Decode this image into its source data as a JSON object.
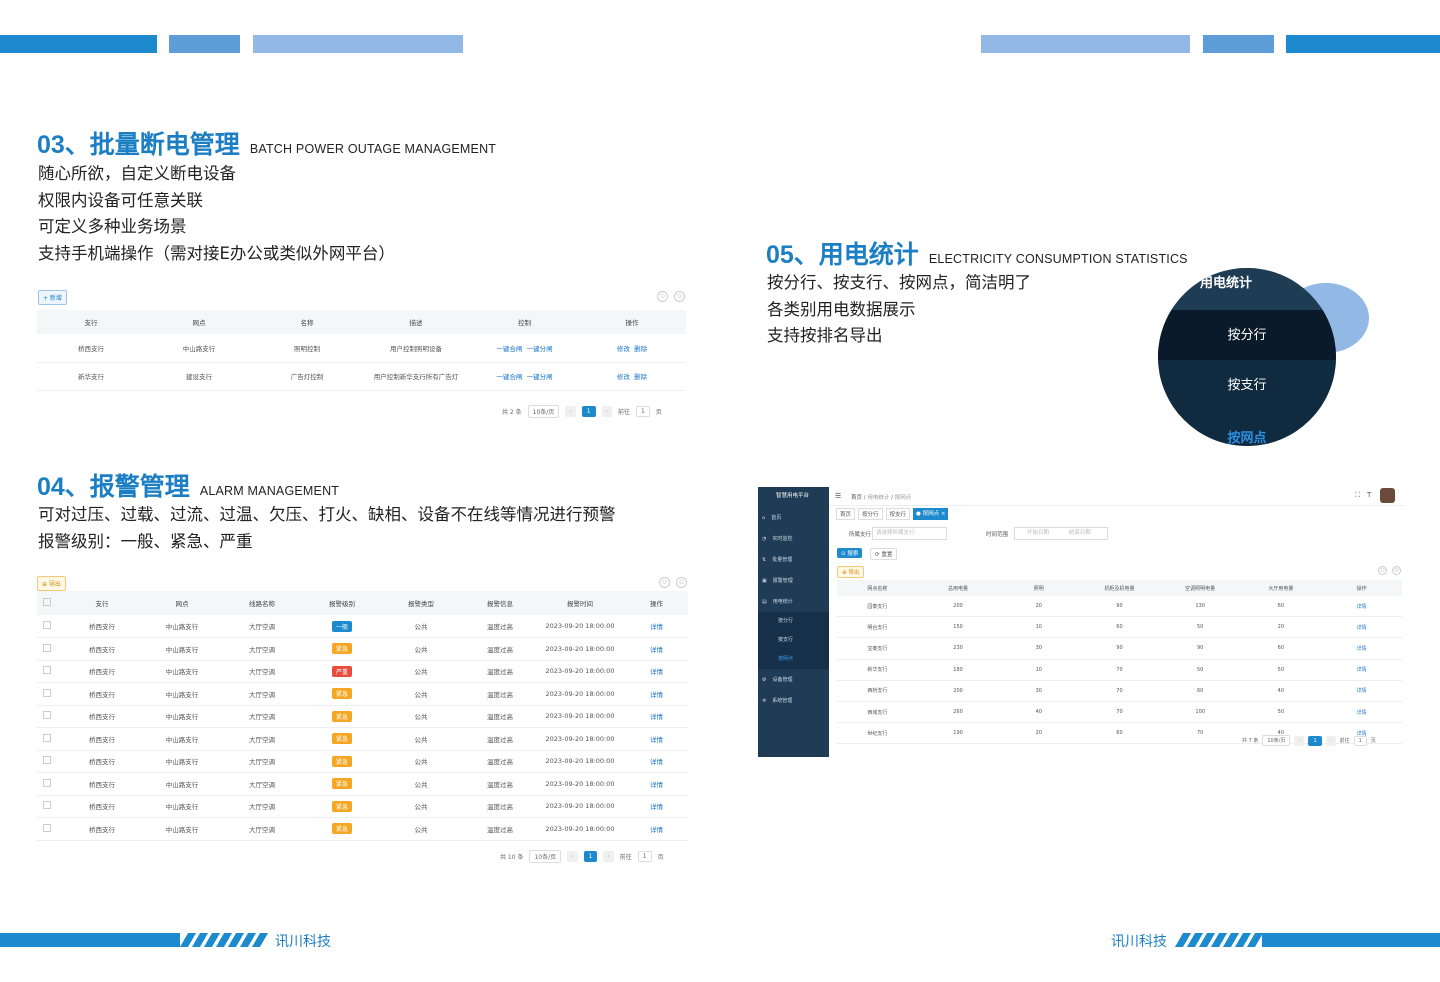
{
  "sections": {
    "s03": {
      "title": "03、批量断电管理",
      "en": "BATCH POWER OUTAGE MANAGEMENT",
      "lines": [
        "随心所欲，自定义断电设备",
        "权限内设备可任意关联",
        "可定义多种业务场景",
        "支持手机端操作（需对接E办公或类似外网平台）"
      ]
    },
    "s04": {
      "title": "04、报警管理",
      "en": "ALARM MANAGEMENT",
      "lines": [
        "可对过压、过载、过流、过温、欠压、打火、缺相、设备不在线等情况进行预警",
        "报警级别：一般、紧急、严重"
      ]
    },
    "s05": {
      "title": "05、用电统计",
      "en": "ELECTRICITY CONSUMPTION STATISTICS",
      "lines": [
        "按分行、按支行、按网点，简洁明了",
        "各类别用电数据展示",
        "支持按排名导出"
      ]
    }
  },
  "power_panel": {
    "add_button": "+ 新增",
    "columns": [
      "支行",
      "网点",
      "名称",
      "描述",
      "控制",
      "操作"
    ],
    "rows": [
      {
        "branch": "桥西支行",
        "outlet": "中山路支行",
        "name": "照明控制",
        "desc": "用户控制照明设备",
        "ctrl_on": "一键合闸",
        "ctrl_off": "一键分闸",
        "edit": "修改",
        "del": "删除"
      },
      {
        "branch": "新华支行",
        "outlet": "建设支行",
        "name": "广告灯控制",
        "desc": "用户控制新华支行所有广告灯",
        "ctrl_on": "一键合闸",
        "ctrl_off": "一键分闸",
        "edit": "修改",
        "del": "删除"
      }
    ],
    "pager": {
      "total": "共 2 条",
      "size": "10条/页",
      "page": "1",
      "goto": "前往",
      "goto_val": "1",
      "unit": "页"
    }
  },
  "alarm_panel": {
    "export_button": "⊕ 导出",
    "columns": [
      "支行",
      "网点",
      "线路名称",
      "报警级别",
      "报警类型",
      "报警信息",
      "报警时间",
      "操作"
    ],
    "rows": [
      {
        "branch": "桥西支行",
        "outlet": "中山路支行",
        "line": "大厅空调",
        "level": "一般",
        "type": "公共",
        "info": "温度过高",
        "time": "2023-09-20 18:00:00",
        "op": "详情"
      },
      {
        "branch": "桥西支行",
        "outlet": "中山路支行",
        "line": "大厅空调",
        "level": "紧急",
        "type": "公共",
        "info": "温度过高",
        "time": "2023-09-20 18:00:00",
        "op": "详情"
      },
      {
        "branch": "桥西支行",
        "outlet": "中山路支行",
        "line": "大厅空调",
        "level": "严重",
        "type": "公共",
        "info": "温度过高",
        "time": "2023-09-20 18:00:00",
        "op": "详情"
      },
      {
        "branch": "桥西支行",
        "outlet": "中山路支行",
        "line": "大厅空调",
        "level": "紧急",
        "type": "公共",
        "info": "温度过高",
        "time": "2023-09-20 18:00:00",
        "op": "详情"
      },
      {
        "branch": "桥西支行",
        "outlet": "中山路支行",
        "line": "大厅空调",
        "level": "紧急",
        "type": "公共",
        "info": "温度过高",
        "time": "2023-09-20 18:00:00",
        "op": "详情"
      },
      {
        "branch": "桥西支行",
        "outlet": "中山路支行",
        "line": "大厅空调",
        "level": "紧急",
        "type": "公共",
        "info": "温度过高",
        "time": "2023-09-20 18:00:00",
        "op": "详情"
      },
      {
        "branch": "桥西支行",
        "outlet": "中山路支行",
        "line": "大厅空调",
        "level": "紧急",
        "type": "公共",
        "info": "温度过高",
        "time": "2023-09-20 18:00:00",
        "op": "详情"
      },
      {
        "branch": "桥西支行",
        "outlet": "中山路支行",
        "line": "大厅空调",
        "level": "紧急",
        "type": "公共",
        "info": "温度过高",
        "time": "2023-09-20 18:00:00",
        "op": "详情"
      },
      {
        "branch": "桥西支行",
        "outlet": "中山路支行",
        "line": "大厅空调",
        "level": "紧急",
        "type": "公共",
        "info": "温度过高",
        "time": "2023-09-20 18:00:00",
        "op": "详情"
      },
      {
        "branch": "桥西支行",
        "outlet": "中山路支行",
        "line": "大厅空调",
        "level": "紧急",
        "type": "公共",
        "info": "温度过高",
        "time": "2023-09-20 18:00:00",
        "op": "详情"
      }
    ],
    "level_colors": {
      "一般": "#1c8acc",
      "紧急": "#f5a623",
      "严重": "#e74c3c"
    },
    "pager": {
      "total": "共 10 条",
      "size": "10条/页",
      "page": "1",
      "goto": "前往",
      "goto_val": "1",
      "unit": "页"
    }
  },
  "stats_menu": {
    "header": "用电统计",
    "items": [
      "按分行",
      "按支行",
      "按网点"
    ]
  },
  "dashboard": {
    "logo": "智慧用电平台",
    "breadcrumb": [
      "首页",
      "用电统计",
      "按网点"
    ],
    "tabs": [
      "首页",
      "按分行",
      "按支行",
      "● 按网点 ×"
    ],
    "nav": [
      {
        "label": "首页",
        "icon": "home-icon"
      },
      {
        "label": "实时监控",
        "icon": "monitor-icon"
      },
      {
        "label": "批量管理",
        "icon": "batch-icon"
      },
      {
        "label": "报警管理",
        "icon": "alarm-icon"
      },
      {
        "label": "用电统计",
        "icon": "stats-icon"
      },
      {
        "label": "按分行",
        "icon": ""
      },
      {
        "label": "按支行",
        "icon": ""
      },
      {
        "label": "按网点",
        "icon": ""
      },
      {
        "label": "设备管理",
        "icon": "device-icon"
      },
      {
        "label": "系统管理",
        "icon": "settings-icon"
      }
    ],
    "filter": {
      "branch_label": "所属支行",
      "branch_placeholder": "请选择所属支行",
      "date_label": "时间范围",
      "start_placeholder": "开始日期",
      "end_placeholder": "结束日期"
    },
    "search_button": "⊙ 搜索",
    "reset_button": "⟳ 重置",
    "export_button": "⊕ 导出",
    "columns": [
      "网点名称",
      "总用电量",
      "照明",
      "机柜及机电量",
      "空调照明电量",
      "大厅用电量",
      "操作"
    ],
    "rows": [
      [
        "园泰支行",
        "200",
        "20",
        "90",
        "130",
        "60",
        "详情"
      ],
      [
        "明台支行",
        "150",
        "10",
        "60",
        "50",
        "20",
        "详情"
      ],
      [
        "宝泰支行",
        "230",
        "30",
        "90",
        "90",
        "60",
        "详情"
      ],
      [
        "新华支行",
        "180",
        "10",
        "70",
        "50",
        "50",
        "详情"
      ],
      [
        "西桥支行",
        "200",
        "30",
        "70",
        "60",
        "40",
        "详情"
      ],
      [
        "西城支行",
        "260",
        "40",
        "70",
        "100",
        "50",
        "详情"
      ],
      [
        "世纪支行",
        "190",
        "20",
        "60",
        "70",
        "40",
        "详情"
      ]
    ],
    "pager": {
      "total": "共 7 条",
      "size": "10条/页",
      "page": "1",
      "goto": "前往",
      "goto_val": "1",
      "unit": "页"
    }
  },
  "footer": {
    "brand_left": "讯川科技",
    "brand_right": "讯川科技"
  }
}
